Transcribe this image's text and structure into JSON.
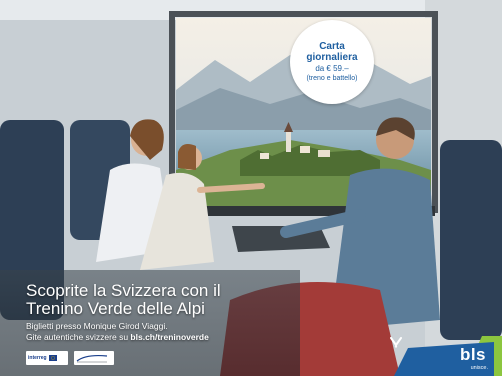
{
  "badge": {
    "line1": "Carta",
    "line2": "giornaliera",
    "line3": "da € 59.–",
    "line4": "(treno e battello)"
  },
  "headline": {
    "line1": "Scoprite la Svizzera con il",
    "line2": "Trenino Verde delle Alpi"
  },
  "info": {
    "line1": "Biglietti presso Monique Girod Viaggi.",
    "line2_prefix": "Gite autentiche svizzere su ",
    "line2_link": "bls.ch/treninoverde"
  },
  "logos": {
    "interreg_text": "interreg"
  },
  "bls": {
    "name": "bls",
    "tagline": "unisce."
  },
  "colors": {
    "badge_text": "#1f5fa0",
    "bls_blue": "#1f5fa0",
    "bls_green": "#8cc63f"
  }
}
